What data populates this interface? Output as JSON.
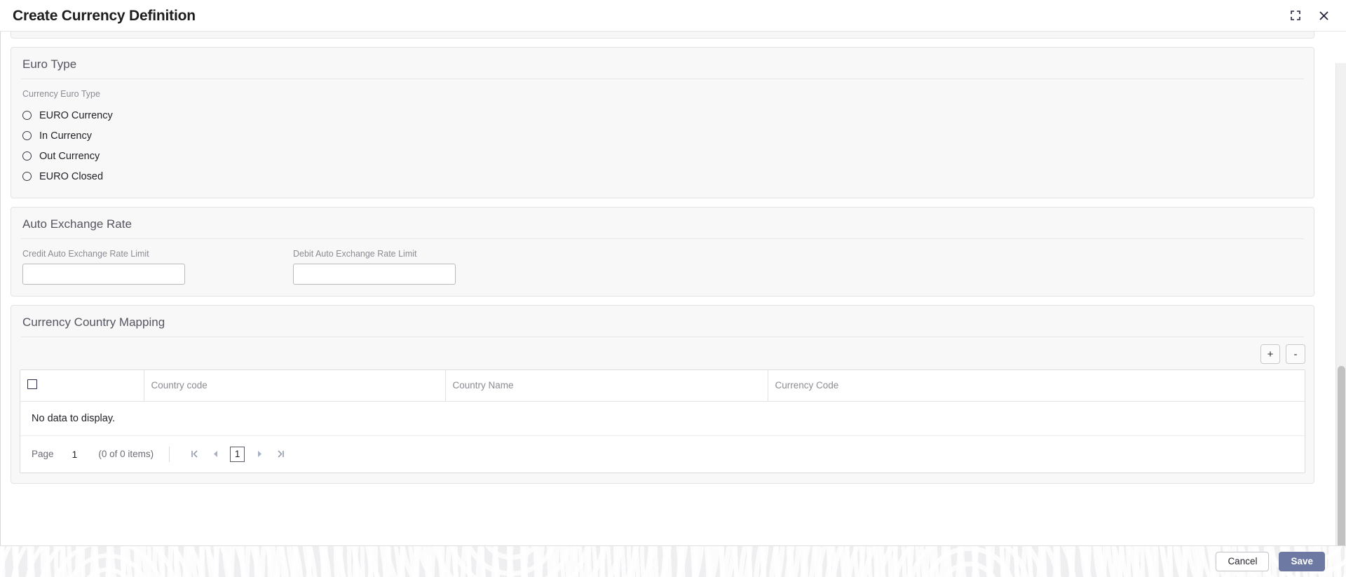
{
  "window": {
    "title": "Create Currency Definition",
    "restore_icon": "restore-collapse-icon",
    "close_icon": "close-icon"
  },
  "sections": {
    "euro_type": {
      "title": "Euro Type",
      "field_label": "Currency Euro Type",
      "options": [
        {
          "label": "EURO Currency",
          "selected": false
        },
        {
          "label": "In Currency",
          "selected": false
        },
        {
          "label": "Out Currency",
          "selected": false
        },
        {
          "label": "EURO Closed",
          "selected": false
        }
      ]
    },
    "auto_exchange_rate": {
      "title": "Auto Exchange Rate",
      "fields": [
        {
          "label": "Credit Auto Exchange Rate Limit",
          "value": "",
          "placeholder": ""
        },
        {
          "label": "Debit Auto Exchange Rate Limit",
          "value": "",
          "placeholder": ""
        }
      ]
    },
    "currency_country_mapping": {
      "title": "Currency Country Mapping",
      "toolbar": {
        "add_label": "+",
        "remove_label": "-"
      },
      "table": {
        "columns": [
          "Country code",
          "Country Name",
          "Currency Code"
        ],
        "rows": [],
        "empty_message": "No data to display."
      },
      "pagination": {
        "page_label": "Page",
        "page_number": "1",
        "items_label": "(0 of 0 items)",
        "current_page": "1",
        "first_icon": "first-page-icon",
        "prev_icon": "previous-page-icon",
        "next_icon": "next-page-icon",
        "last_icon": "last-page-icon"
      }
    }
  },
  "footer": {
    "cancel_label": "Cancel",
    "save_label": "Save"
  },
  "colors": {
    "save_button": "#6e79a3",
    "panel_background": "#f8f8f8",
    "title_text": "#1d1d1d",
    "muted_text": "#8b8b93"
  }
}
